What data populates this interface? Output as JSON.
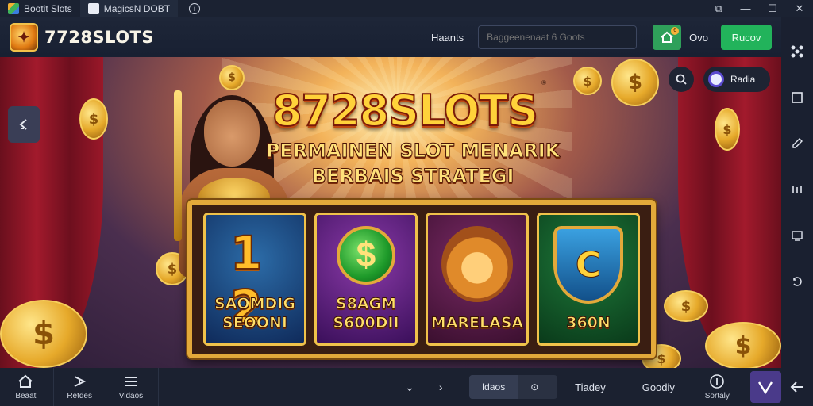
{
  "titlebar": {
    "tabs": [
      {
        "label": "Bootit Slots",
        "icon": "app-cube-icon"
      },
      {
        "label": "MagicsN DOBT",
        "icon": "app-page-icon"
      }
    ],
    "info_icon": "info-icon",
    "controls": [
      "external-icon",
      "minimize-icon",
      "maximize-icon",
      "close-icon"
    ]
  },
  "header": {
    "brand": "7728SLOTS",
    "nav_link": "Haants",
    "search_placeholder": "Baggeenenaat 6 Goots",
    "home_badge": "6",
    "counter": "Ovo",
    "action_label": "Rucov"
  },
  "banner": {
    "title": "8728SLOTS",
    "subtitle_line1": "PERMAINEN SLOT MENARIK",
    "subtitle_line2": "BERBAIS STRATEGI",
    "user_label": "Radia",
    "cards": [
      {
        "art": "1 2",
        "line1": "SAOMDIG",
        "line2": "SEOONI"
      },
      {
        "art": "$",
        "line1": "S8AGM",
        "line2": "S600DII"
      },
      {
        "art": "lion",
        "line1": "MARELASA",
        "line2": ""
      },
      {
        "art": "C",
        "line1": "",
        "line2": "360N"
      }
    ]
  },
  "bottom": {
    "nav": [
      {
        "label": "Beaat",
        "icon": "home-icon"
      },
      {
        "label": "Retdes",
        "icon": "share-icon"
      },
      {
        "label": "Vidaos",
        "icon": "list-icon"
      }
    ],
    "segments": [
      "Idaos",
      "⊙ 3"
    ],
    "links": [
      "Tiadey",
      "Goodiy"
    ],
    "settings_label": "Sortaly"
  },
  "colors": {
    "accent_green": "#22b35b",
    "gold": "#ffd23a",
    "purple_button": "#4a3a8a"
  }
}
